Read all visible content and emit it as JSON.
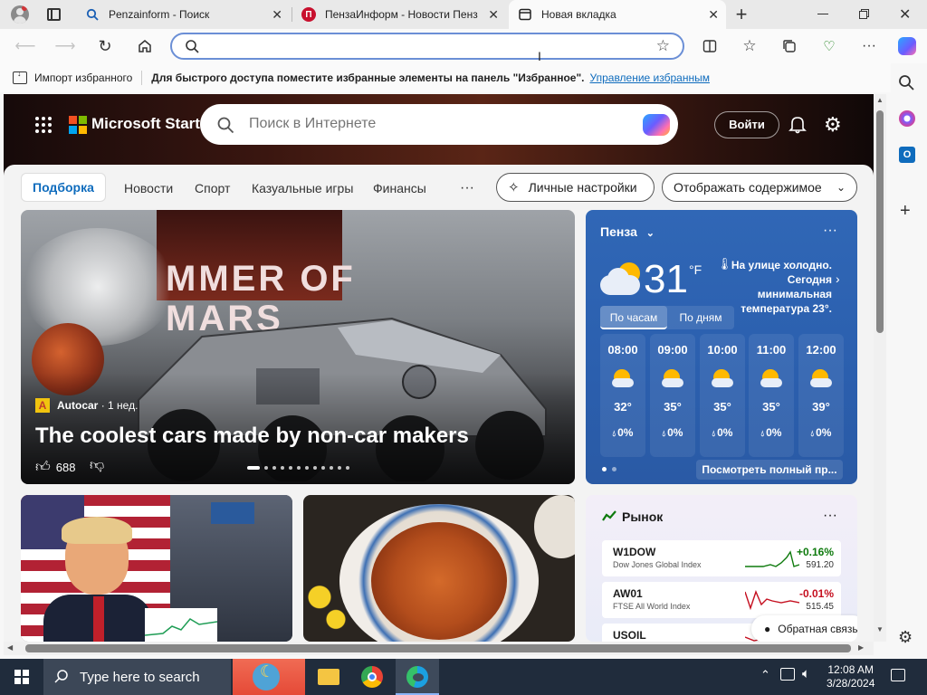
{
  "tabs": [
    {
      "title": "Penzainform - Поиск",
      "icon": "search-icon"
    },
    {
      "title": "ПензаИнформ - Новости Пенз",
      "icon": "penzainform-logo-icon"
    },
    {
      "title": "Новая вкладка",
      "icon": "newtab-icon"
    }
  ],
  "window": {
    "new_tab_symbol": "+"
  },
  "address_bar": {
    "value": "",
    "placeholder": ""
  },
  "favorites_bar": {
    "import_label": "Импорт избранного",
    "message": "Для быстрого доступа поместите избранные элементы на панель \"Избранное\".",
    "manage_link": "Управление избранным"
  },
  "msn": {
    "brand": "Microsoft Start",
    "search_placeholder": "Поиск в Интернете",
    "login_label": "Войти",
    "nav": [
      "Подборка",
      "Новости",
      "Спорт",
      "Казуальные игры",
      "Финансы"
    ],
    "nav_more": "···",
    "personalize_label": "Личные настройки",
    "content_display_label": "Отображать содержимое",
    "accent_color": "#0f6cbd"
  },
  "hero": {
    "billboard_text": "MMER OF\nMARS",
    "source": "Autocar",
    "age": "· 1 нед.",
    "title": "The coolest cars made by non-car makers",
    "likes": "688",
    "pager_count": 12,
    "pager_active": 0
  },
  "weather": {
    "city": "Пенза",
    "temp": "31",
    "unit": "°F",
    "alert_line1": "На улице холодно.",
    "alert_line2": "Сегодня минимальная",
    "alert_line3": "температура 23°.",
    "tab_hourly": "По часам",
    "tab_daily": "По дням",
    "hours": [
      {
        "time": "08:00",
        "temp": "32°",
        "precip": "0%"
      },
      {
        "time": "09:00",
        "temp": "35°",
        "precip": "0%"
      },
      {
        "time": "10:00",
        "temp": "35°",
        "precip": "0%"
      },
      {
        "time": "11:00",
        "temp": "35°",
        "precip": "0%"
      },
      {
        "time": "12:00",
        "temp": "39°",
        "precip": "0%"
      }
    ],
    "see_full": "Посмотреть полный пр..."
  },
  "market": {
    "title": "Рынок",
    "rows": [
      {
        "symbol": "W1DOW",
        "name": "Dow Jones Global Index",
        "change": "+0.16%",
        "value": "591.20",
        "color": "#0e7a0d"
      },
      {
        "symbol": "AW01",
        "name": "FTSE All World Index",
        "change": "-0.01%",
        "value": "515.45",
        "color": "#c50f1f"
      },
      {
        "symbol": "USOIL",
        "name": "",
        "change": "",
        "value": "",
        "color": "#c50f1f"
      }
    ],
    "feedback_label": "Обратная связь"
  },
  "taskbar": {
    "search_placeholder": "Type here to search",
    "time": "12:08 AM",
    "date": "3/28/2024"
  }
}
